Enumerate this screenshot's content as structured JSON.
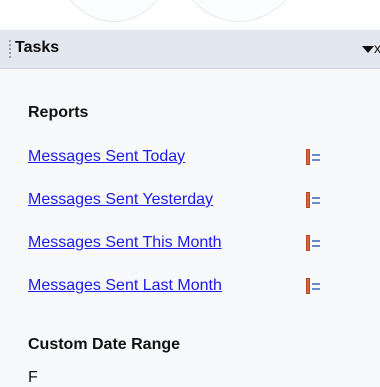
{
  "panel": {
    "title": "Tasks",
    "dropdown_icon": "chevron-down-icon",
    "close_icon": "close-icon"
  },
  "reports": {
    "heading": "Reports",
    "links": [
      {
        "label": "Messages Sent Today",
        "icon": "report-icon"
      },
      {
        "label": "Messages Sent Yesterday",
        "icon": "report-icon"
      },
      {
        "label": "Messages Sent This Month",
        "icon": "report-icon"
      },
      {
        "label": "Messages Sent Last Month",
        "icon": "report-icon"
      }
    ]
  },
  "custom_range": {
    "heading": "Custom Date Range",
    "partial_label": "F"
  },
  "colors": {
    "link": "#1a1aee",
    "header_bg": "#e3e7f0",
    "panel_bg": "#f8f9fb"
  }
}
